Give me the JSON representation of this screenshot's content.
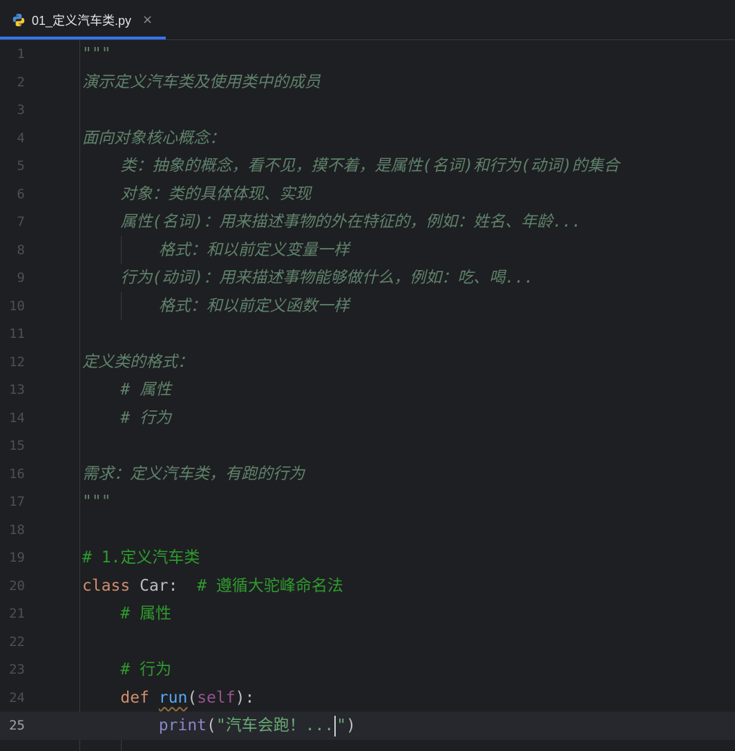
{
  "tab": {
    "filename": "01_定义汽车类.py",
    "close": "×"
  },
  "lines": {
    "l1": {
      "num": "1",
      "text": "\"\"\""
    },
    "l2": {
      "num": "2",
      "text": "演示定义汽车类及使用类中的成员"
    },
    "l3": {
      "num": "3",
      "text": ""
    },
    "l4": {
      "num": "4",
      "text": "面向对象核心概念："
    },
    "l5": {
      "num": "5",
      "text": "    类：抽象的概念，看不见，摸不着，是属性(名词)和行为(动词)的集合"
    },
    "l6": {
      "num": "6",
      "text": "    对象：类的具体体现、实现"
    },
    "l7": {
      "num": "7",
      "text": "    属性(名词)：用来描述事物的外在特征的，例如：姓名、年龄..."
    },
    "l8": {
      "num": "8",
      "text": "        格式：和以前定义变量一样"
    },
    "l9": {
      "num": "9",
      "text": "    行为(动词)：用来描述事物能够做什么，例如：吃、喝..."
    },
    "l10": {
      "num": "10",
      "text": "        格式：和以前定义函数一样"
    },
    "l11": {
      "num": "11",
      "text": ""
    },
    "l12": {
      "num": "12",
      "text": "定义类的格式："
    },
    "l13": {
      "num": "13",
      "text": "    # 属性"
    },
    "l14": {
      "num": "14",
      "text": "    # 行为"
    },
    "l15": {
      "num": "15",
      "text": ""
    },
    "l16": {
      "num": "16",
      "text": "需求：定义汽车类，有跑的行为"
    },
    "l17": {
      "num": "17",
      "text": "\"\"\""
    },
    "l18": {
      "num": "18",
      "text": ""
    },
    "l19": {
      "num": "19",
      "comment": "# 1.定义汽车类"
    },
    "l20": {
      "num": "20",
      "kw": "class",
      "name": " Car:  ",
      "comment": "# 遵循大驼峰命名法"
    },
    "l21": {
      "num": "21",
      "indent": "    ",
      "comment": "# 属性"
    },
    "l22": {
      "num": "22"
    },
    "l23": {
      "num": "23",
      "indent": "    ",
      "comment": "# 行为"
    },
    "l24": {
      "num": "24",
      "indent": "    ",
      "kw": "def",
      "sp": " ",
      "fn": "run",
      "p1": "(",
      "self": "self",
      "p2": "):"
    },
    "l25": {
      "num": "25",
      "indent": "        ",
      "bi": "print",
      "p1": "(",
      "str_a": "\"汽车会跑！...",
      "str_b": "\"",
      "p2": ")"
    }
  }
}
